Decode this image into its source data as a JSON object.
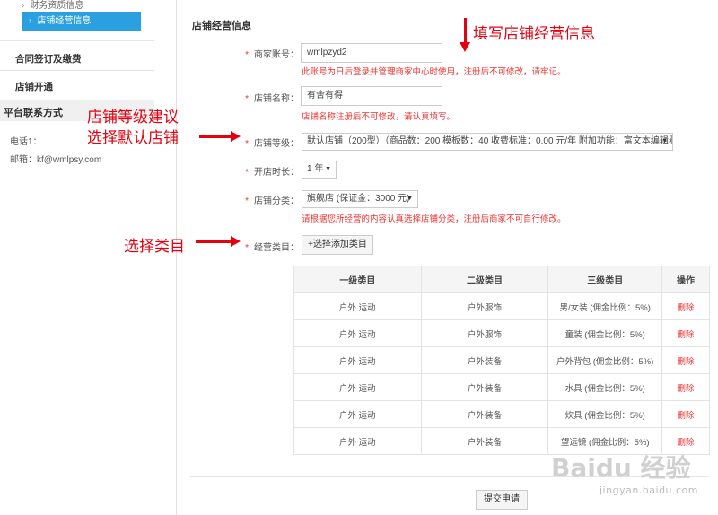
{
  "sidebar": {
    "sub_top": "财务资质信息",
    "active_item": "店铺经营信息",
    "contract": "合同签订及缴费",
    "store_open": "店铺开通",
    "contact_title": "平台联系方式",
    "phone": "电话1：",
    "email": "邮箱：kf@wmlpsy.com",
    "bullet": "›"
  },
  "section_title": "店铺经营信息",
  "required_mark": "*",
  "form": {
    "account": {
      "label": "商家账号：",
      "value": "wmlpzyd2",
      "hint": "此账号为日后登录并管理商家中心时使用，注册后不可修改，请牢记。"
    },
    "store_name": {
      "label": "店铺名称：",
      "value": "有舍有得",
      "hint": "店铺名称注册后不可修改，请认真填写。"
    },
    "store_level": {
      "label": "店铺等级：",
      "value": "默认店铺（200型）（商品数：200 模板数：40 收费标准：0.00 元/年 附加功能：富文本编辑器）"
    },
    "duration": {
      "label": "开店时长：",
      "value": "1 年"
    },
    "category": {
      "label": "店铺分类：",
      "value": "旗舰店 (保证金：3000 元)",
      "hint": "请根据您所经营的内容认真选择店铺分类，注册后商家不可自行修改。"
    },
    "business_cat": {
      "label": "经营类目：",
      "button": "+选择添加类目"
    }
  },
  "table": {
    "headers": [
      "一级类目",
      "二级类目",
      "三级类目",
      "操作"
    ],
    "rows": [
      [
        "户外 运动",
        "户外服饰",
        "男/女装 (佣金比例：5%)",
        "删除"
      ],
      [
        "户外 运动",
        "户外服饰",
        "童装 (佣金比例：5%)",
        "删除"
      ],
      [
        "户外 运动",
        "户外装备",
        "户外背包 (佣金比例：5%)",
        "删除"
      ],
      [
        "户外 运动",
        "户外装备",
        "水具 (佣金比例：5%)",
        "删除"
      ],
      [
        "户外 运动",
        "户外装备",
        "炊具 (佣金比例：5%)",
        "删除"
      ],
      [
        "户外 运动",
        "户外装备",
        "望远镜 (佣金比例：5%)",
        "删除"
      ]
    ]
  },
  "submit": "提交申请",
  "annotations": {
    "top": "填写店铺经营信息",
    "level_line1": "店铺等级建议",
    "level_line2": "选择默认店铺",
    "category": "选择类目"
  },
  "watermark": {
    "brand": "Baidu 经验",
    "url": "jingyan.baidu.com"
  },
  "colors": {
    "accent": "#2aa0e0",
    "danger": "#e33333",
    "annotation": "#e4000f"
  }
}
